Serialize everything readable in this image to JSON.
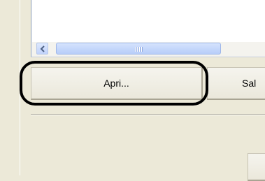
{
  "buttons": {
    "open_label": "Apri...",
    "save_label": "Sal"
  },
  "colors": {
    "window_bg": "#ece9d8",
    "scroll_thumb": "#c1d3fb",
    "highlight_ring": "#000000"
  },
  "icons": {
    "scroll_left": "chevron-left-icon",
    "scroll_grip": "grip-icon"
  }
}
